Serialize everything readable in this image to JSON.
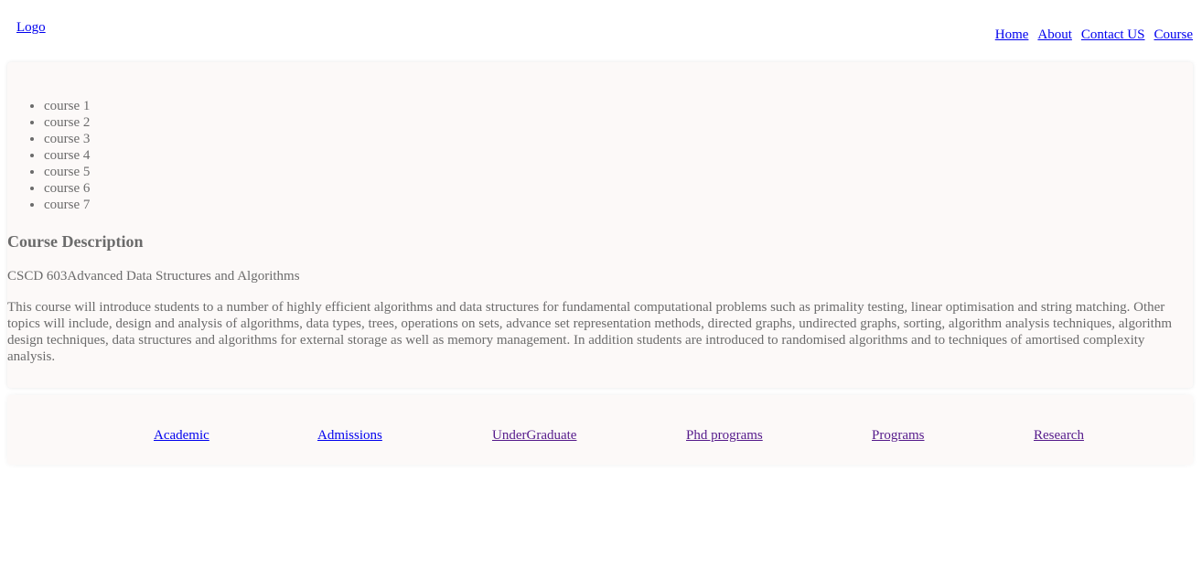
{
  "header": {
    "logo": "Logo",
    "nav": [
      "Home",
      "About",
      "Contact US",
      "Course"
    ]
  },
  "courses": [
    "course 1",
    "course 2",
    "course 3",
    "course 4",
    "course 5",
    "course 6",
    "course 7"
  ],
  "description": {
    "heading": "Course Description",
    "course_title": "CSCD 603Advanced Data Structures and Algorithms",
    "body": "This course will introduce students to a number of highly efficient algorithms and data structures for fundamental computational problems such as primality testing, linear optimisation and string matching. Other topics will include, design and analysis of algorithms, data types, trees, operations on sets, advance set representation methods, directed graphs, undirected graphs, sorting, algorithm analysis techniques, algorithm design techniques, data structures and algorithms for external storage as well as memory management. In addition students are introduced to randomised algorithms and to techniques of amortised complexity analysis."
  },
  "footer": {
    "links": [
      "Academic",
      "Admissions",
      "UnderGraduate",
      "Phd programs",
      "Programs",
      "Research"
    ]
  },
  "colors": {
    "link": "#0000ee",
    "visited_link": "#551a8b",
    "panel_bg": "#fcf9f8",
    "text": "#6b6b6b"
  }
}
